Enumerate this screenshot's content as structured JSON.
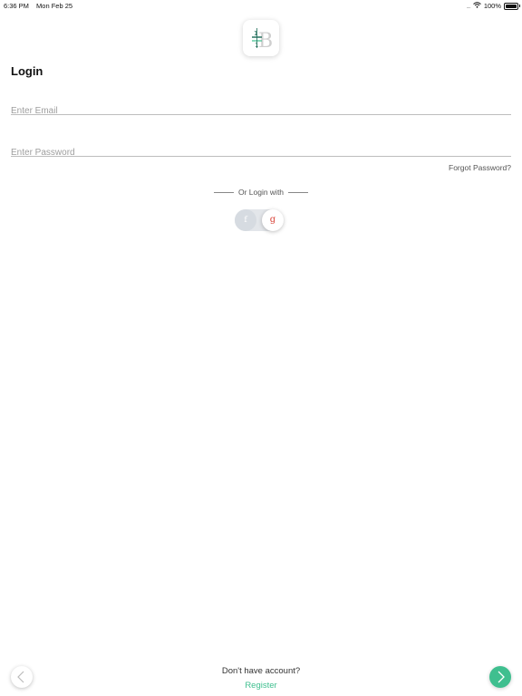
{
  "status_bar": {
    "time": "6:36 PM",
    "date": "Mon Feb 25",
    "battery": "100%"
  },
  "logo": {
    "icon": "app-logo-icon"
  },
  "page_title": "Login",
  "email": {
    "placeholder": "Enter Email",
    "value": ""
  },
  "password": {
    "placeholder": "Enter Password",
    "value": ""
  },
  "forgot_password": "Forgot Password?",
  "social_login": {
    "label": "Or Login with",
    "facebook_glyph": "f",
    "google_glyph": "g"
  },
  "footer": {
    "question": "Don't have account?",
    "register": "Register"
  },
  "colors": {
    "accent": "#3fbf8f",
    "google_red": "#d9453a"
  }
}
